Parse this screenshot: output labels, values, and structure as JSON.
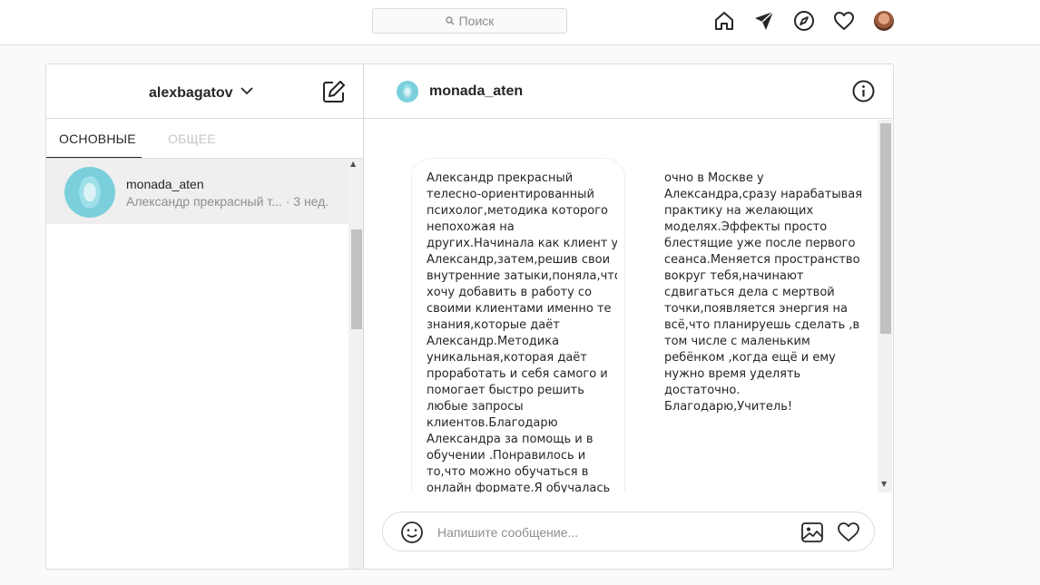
{
  "topbar": {
    "search_placeholder": "Поиск",
    "icons": [
      "home-icon",
      "direct-icon",
      "explore-icon",
      "activity-heart-icon",
      "profile-avatar"
    ]
  },
  "sidebar": {
    "account_name": "alexbagatov",
    "tabs": [
      {
        "label": "ОСНОВНЫЕ",
        "active": true
      },
      {
        "label": "ОБЩЕЕ",
        "active": false
      }
    ],
    "threads": [
      {
        "name": "monada_aten",
        "preview": "Александр прекрасный т...",
        "time": "· 3 нед."
      }
    ]
  },
  "chat": {
    "username": "monada_aten",
    "message_col1": [
      "Александр прекрасный",
      "телесно-ориентированный",
      "психолог,методика которого",
      "непохожая на",
      "других.Начинала как клиент у",
      "Александр,затем,решив свои",
      "внутренние затыки,поняла,что",
      "хочу добавить в работу со",
      "своими клиентами именно те",
      "знания,которые даёт",
      "Александр.Методика",
      "уникальная,которая даёт",
      "проработать и себя самого и",
      "помогает быстро решить",
      "любые запросы",
      "клиентов.Благодарю",
      "Александра за помощь и в",
      "обучении .Понравилось и",
      "то,что можно обучаться в",
      "онлайн формате.Я обучалась"
    ],
    "message_col2": [
      "очно в Москве у",
      "Александра,сразу нарабатывая",
      "практику на желающих",
      "моделях.Эффекты просто",
      "блестящие уже после первого",
      "сеанса.Меняется пространство",
      "вокруг тебя,начинают",
      "сдвигаться дела с мертвой",
      "точки,появляется энергия на",
      "всё,что планируешь сделать ,в",
      "том числе с маленьким",
      "ребёнком ,когда ещё и ему",
      "нужно время уделять",
      "достаточно.",
      "Благодарю,Учитель!"
    ],
    "input_placeholder": "Напишите сообщение..."
  },
  "colors": {
    "border": "#dbdbdb",
    "muted_text": "#8e8e8e",
    "selected_thread_bg": "#efefef"
  }
}
